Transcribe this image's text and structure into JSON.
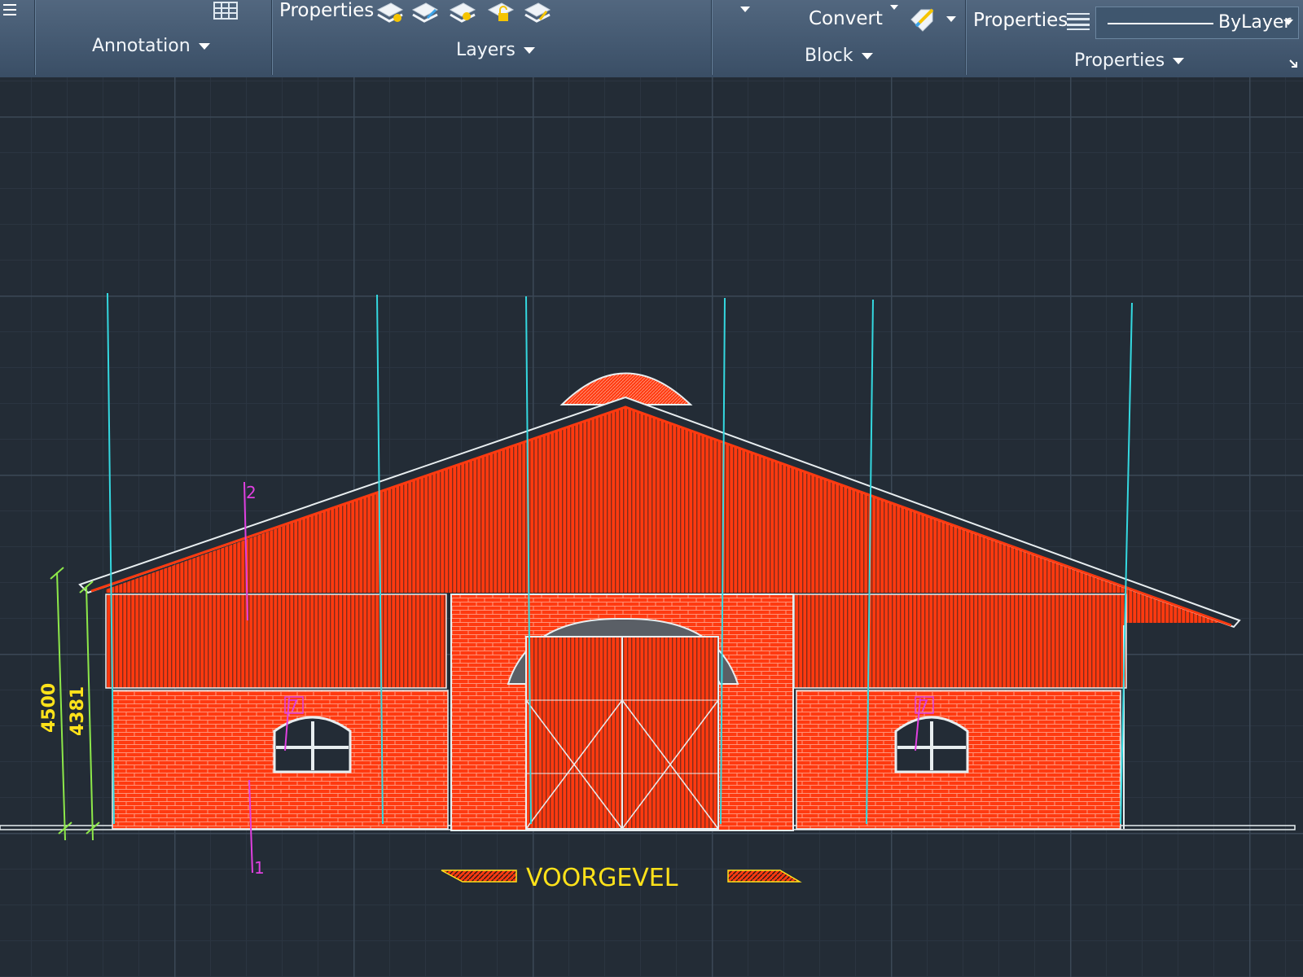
{
  "ribbon": {
    "panels": {
      "annotation": {
        "title": "Annotation"
      },
      "layers": {
        "title": "Layers",
        "properties_label": "Properties"
      },
      "block": {
        "title": "Block",
        "convert_label": "Convert"
      },
      "properties": {
        "title": "Properties",
        "match_label": "Properties",
        "linetype_value": "ByLayer"
      }
    }
  },
  "drawing": {
    "title": "VOORGEVEL",
    "dimensions": [
      "4500",
      "4381"
    ],
    "section_marks": [
      "1",
      "2"
    ],
    "window_marks": [
      "7",
      "7"
    ],
    "colors": {
      "brick": "#ff3a10",
      "outline": "#e8eef0",
      "axis_lines": "#34d8e0",
      "dimension": "#8de84a",
      "dim_text": "#ffe21a",
      "section": "#e040e0"
    }
  }
}
